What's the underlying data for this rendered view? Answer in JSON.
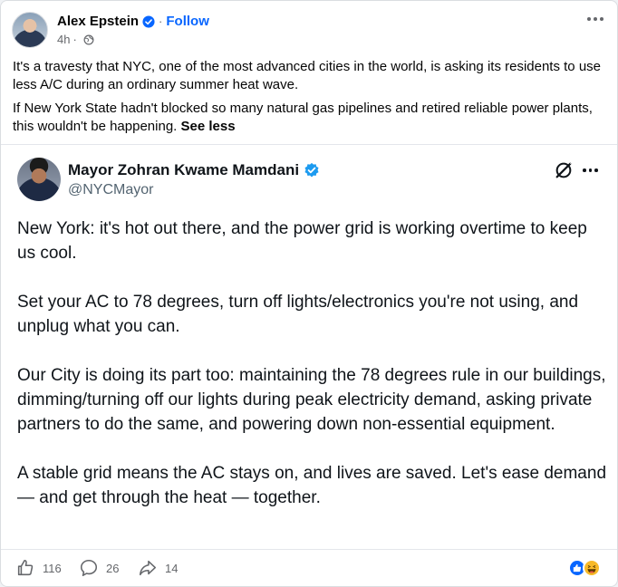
{
  "post": {
    "author": "Alex Epstein",
    "follow_label": "Follow",
    "time": "4h",
    "separator": "·",
    "caption": [
      "It's a travesty that NYC, one of the most advanced cities in the world, is asking its residents to use less A/C during an ordinary summer heat wave.",
      "If New York State hadn't blocked so many natural gas pipelines and retired reliable power plants, this wouldn't be happening."
    ],
    "see_less": "See less",
    "icons": [
      "verified-badge-icon",
      "globe-icon",
      "more-options-icon"
    ]
  },
  "tweet": {
    "name": "Mayor Zohran Kwame Mamdani",
    "handle": "@NYCMayor",
    "paragraphs": [
      "New York: it's hot out there, and the power grid is working overtime to keep us cool.",
      "Set your AC to 78 degrees, turn off lights/electronics you're not using, and unplug what you can.",
      "Our City is doing its part too: maintaining the 78 degrees rule in our buildings, dimming/turning off our lights during peak electricity demand, asking private partners to do the same, and powering down non-essential equipment.",
      "A stable grid means the AC stays on, and lives are saved. Let's ease demand — and get through the heat — together."
    ],
    "icons": [
      "verified-badge-icon",
      "grok-icon",
      "more-options-icon"
    ]
  },
  "actions": {
    "likes": "116",
    "comments": "26",
    "shares": "14",
    "icons": [
      "like-icon",
      "comment-icon",
      "share-icon",
      "reaction-like-icon",
      "reaction-haha-icon"
    ]
  },
  "colors": {
    "link_blue": "#0866ff",
    "verified_blue": "#1d9bf0",
    "muted": "#65676b",
    "text": "#050505"
  }
}
